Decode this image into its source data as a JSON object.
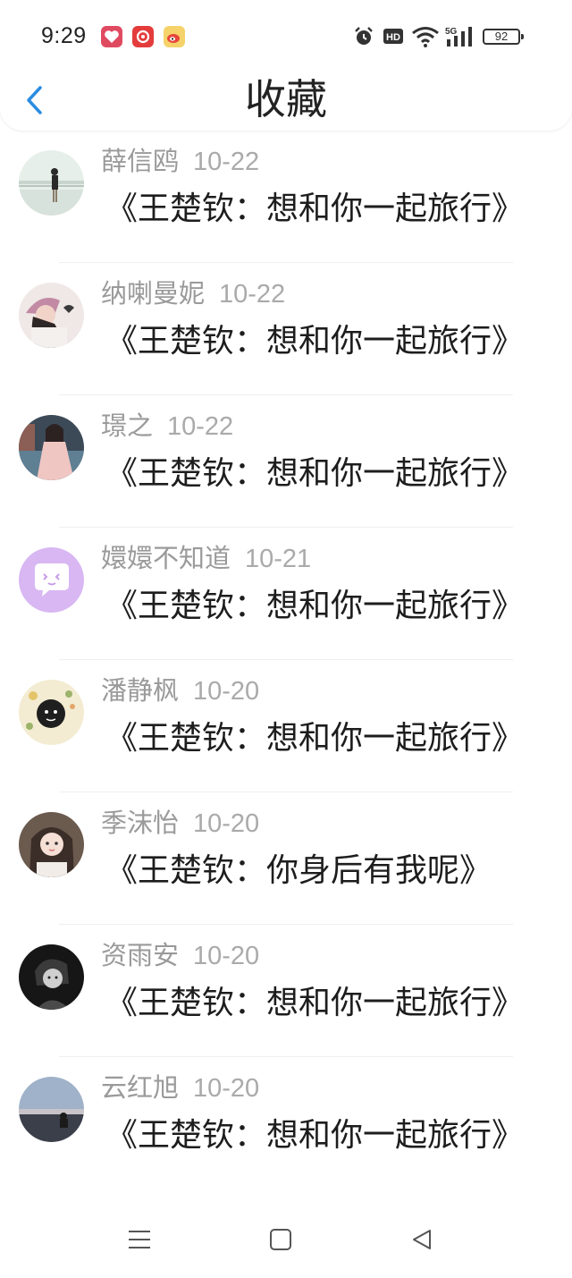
{
  "status_bar": {
    "time": "9:29",
    "battery": "92",
    "network": "5G",
    "hd_label": "HD",
    "app_icons": [
      "heart-app-icon",
      "netease-music-icon",
      "weibo-icon"
    ],
    "indicators": [
      "alarm-icon",
      "hd-icon",
      "wifi-icon",
      "signal-icon"
    ]
  },
  "header": {
    "title": "收藏",
    "back_icon": "chevron-left-icon",
    "accent_color": "#2b8de0"
  },
  "favorites": [
    {
      "user": "薛信鸥",
      "date": "10-22",
      "title": "《王楚钦：想和你一起旅行》",
      "avatar": "girl-on-railing-photo"
    },
    {
      "user": "纳喇曼妮",
      "date": "10-22",
      "title": "《王楚钦：想和你一起旅行》",
      "avatar": "girl-with-hat-photo"
    },
    {
      "user": "璟之",
      "date": "10-22",
      "title": "《王楚钦：想和你一起旅行》",
      "avatar": "girl-pink-dress-photo"
    },
    {
      "user": "嬛嬛不知道",
      "date": "10-21",
      "title": "《王楚钦：想和你一起旅行》",
      "avatar": "default-chat-bubble-avatar"
    },
    {
      "user": "潘静枫",
      "date": "10-20",
      "title": "《王楚钦：想和你一起旅行》",
      "avatar": "cartoon-floral-avatar"
    },
    {
      "user": "季沫怡",
      "date": "10-20",
      "title": "《王楚钦：你身后有我呢》",
      "avatar": "girl-portrait-photo"
    },
    {
      "user": "资雨安",
      "date": "10-20",
      "title": "《王楚钦：想和你一起旅行》",
      "avatar": "dark-anime-avatar"
    },
    {
      "user": "云红旭",
      "date": "10-20",
      "title": "《王楚钦：想和你一起旅行》",
      "avatar": "seaside-dusk-photo"
    }
  ],
  "system_nav": {
    "buttons": [
      "menu-icon",
      "home-square-icon",
      "back-triangle-icon"
    ]
  }
}
